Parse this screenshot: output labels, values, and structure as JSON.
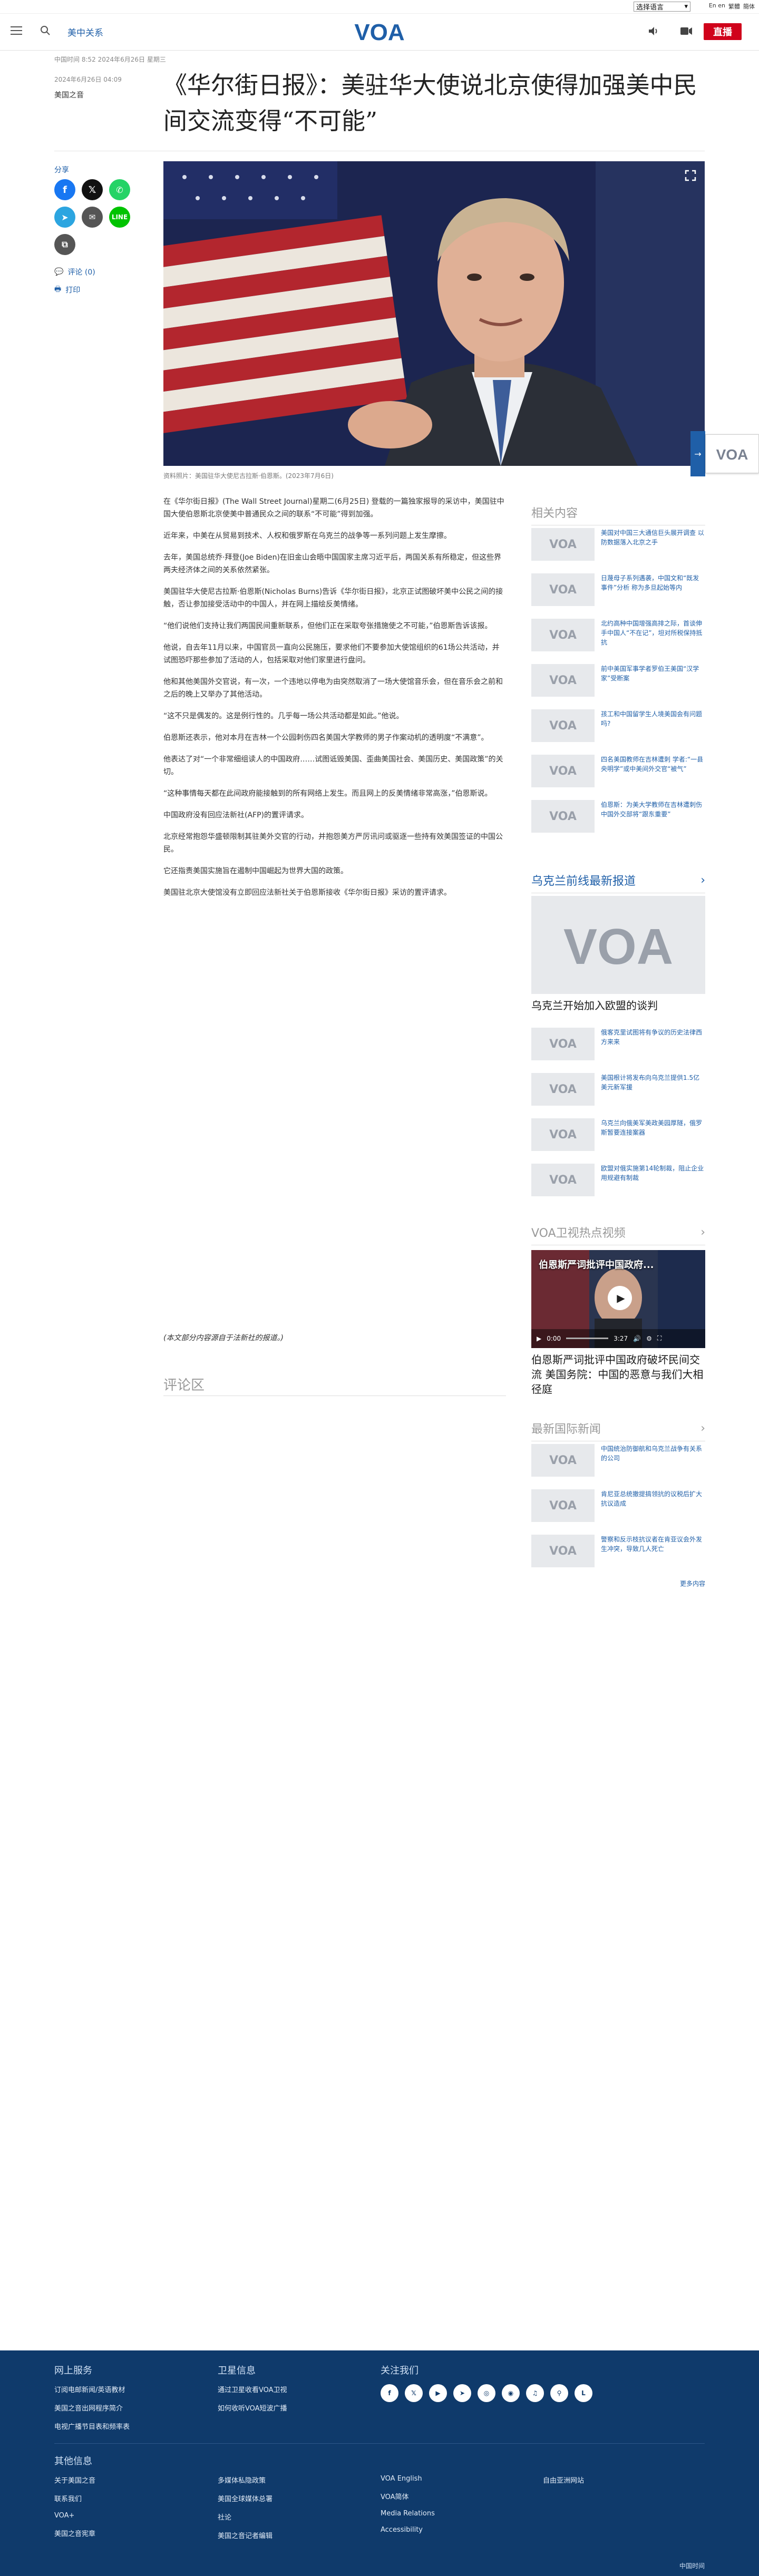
{
  "top_strip": {
    "language_select": "选择语言",
    "lang_links": [
      "En en",
      "繁體",
      "簡体"
    ]
  },
  "header": {
    "section": "美中关系",
    "logo": "VOA",
    "live_label": "直播"
  },
  "article": {
    "breadcrumb": "中国时间 8:52 2024年6月26日 星期三",
    "pub_date": "2024年6月26日 04:09",
    "author": "美国之音",
    "title": "《华尔街日报》：美驻华大使说北京使得加强美中民间交流变得“不可能”",
    "share_label": "分享",
    "comments_label": "评论 (0)",
    "print_label": "打印",
    "caption": "资料照片：美国驻华大使尼古拉斯·伯恩斯。(2023年7月6日)",
    "paragraphs": [
      "在《华尔街日报》(The Wall Street Journal)星期二(6月25日) 登载的一篇独家报导的采访中，美国驻中国大使伯恩斯北京使美中普通民众之间的联系“不可能”得到加强。",
      "近年来，中美在从贸易到技术、人权和俄罗斯在乌克兰的战争等一系列问题上发生摩擦。",
      "去年，美国总统乔·拜登(Joe Biden)在旧金山会晤中国国家主席习近平后，两国关系有所稳定，但这些界两夫经济体之间的关系依然紧张。",
      "美国驻华大使尼古拉斯·伯恩斯(Nicholas Burns)告诉《华尔街日报》，北京正试图破坏美中公民之间的接触，否让参加接受活动中的中国人，并在网上描绘反美情绪。",
      "“他们说他们支持让我们两国民间重新联系，但他们正在采取夸张措施使之不可能，”伯恩斯告诉该报。",
      "他说，自去年11月以来，中国官员一直向公民施压，要求他们不要参加大使馆组织的61场公共活动，并试图恐吓那些参加了活动的人，包括采取对他们家里进行盘问。",
      "他和其他美国外交官说，有一次，一个违地以停电为由突然取消了一场大使馆音乐会，但在音乐会之前和之后的晚上又举办了其他活动。",
      "“这不只是偶发的。这是例行性的。几乎每一场公共活动都是如此。”他说。",
      "伯恩斯还表示，他对本月在吉林一个公园刺伤四名美国大学教师的男子作案动机的透明度“不满意”。",
      "他表达了对“一个非常细组读人的中国政府……试图诋毁美国、歪曲美国社会、美国历史、美国政策”的关切。",
      "“这种事情每天都在此间政府能接触到的所有网络上发生。而且网上的反美情绪非常高涨，”伯恩斯说。",
      "中国政府没有回应法新社(AFP)的置评请求。",
      "北京经常抱怨华盛顿限制其驻美外交官的行动，并抱怨美方严厉讯问或驱逐一些持有效美国签证的中国公民。",
      "它还指责美国实施旨在遏制中国崛起为世界大国的政策。",
      "美国驻北京大使馆没有立即回应法新社关于伯恩斯接收《华尔街日报》采访的置评请求。"
    ],
    "footnote": "(本文部分内容源自于法新社的报道。)",
    "comments_heading": "评论区"
  },
  "related": {
    "heading": "相关内容",
    "items": [
      "美国对中国三大通信巨头展开调查 以防数据落入北京之手",
      "日蔑母子系列遇袭，中国文和“既发事件”分析 称为多旦起始等内",
      "北约高种中国增强高排之际，首谈伸手中国人“不在记”，坦对所税保持抵抗",
      "前中美国军事学者罗伯王美国“汉学家”受断案",
      "孩工和中国留学生人境美国会有问题吗?",
      "四名美国教师在吉林遭刺 学者:“一县央明学”或中美间外交官“被气”",
      "伯恩斯：为美大学教师在吉林遭刺伤中国外交部将“跟东重要”"
    ]
  },
  "ukraine": {
    "heading": "乌克兰前线最新报道",
    "big_title": "乌克兰开始加入欧盟的谈判",
    "items": [
      "俄客克里试图将有争议的历史法律西方来来",
      "美国根计将发布向乌克兰提供1.5亿美元新军援",
      "乌克兰向俄美军美政美园厚隧，俄罗斯暂要连接案器",
      "欧盟对俄实施第14轮制裁，阻止企业用规避有制裁"
    ]
  },
  "video": {
    "heading": "VOA卫视热点视频",
    "overlay_title": "伯恩斯严词批评中国政府...",
    "time": "0:00",
    "duration": "3:27",
    "big_title": "伯恩斯严词批评中国政府破坏民间交流 美国务院：中国的恶意与我们大相径庭"
  },
  "intl": {
    "heading": "最新国际新闻",
    "items": [
      "中国统治防御航和乌克兰战争有关系的公司",
      "肯尼亚总统撤提搞领抗的议税后扩大抗议造成",
      "警察和反示枝抗议者在肯亚议会外发生冲突，导致几人死亡"
    ],
    "more_label": "更多内容"
  },
  "footer": {
    "col1_heading": "网上服务",
    "col1_items": [
      "订阅电邮新闻/英语教材",
      "美国之音出网程序简介",
      "电视广播节目表和频率表"
    ],
    "col2_heading": "卫星信息",
    "col2_items": [
      "通过卫星收看VOA卫视",
      "如何收听VOA短波广播"
    ],
    "col3_heading": "关注我们",
    "social_icons": [
      "facebook-icon",
      "x-icon",
      "youtube-icon",
      "telegram-icon",
      "instagram-icon",
      "rss-icon",
      "podcast-icon",
      "link-icon",
      "line-icon"
    ],
    "other_heading": "其他信息",
    "other_col1": [
      "关于美国之音",
      "联系我们",
      "VOA+",
      "美国之音宪章"
    ],
    "other_col2": [
      "多媒体私隐政策",
      "美国全球媒体总署",
      "社论",
      "美国之音记者编辑"
    ],
    "other_col3": [
      "VOA English",
      "VOA简体",
      "Media Relations",
      "Accessibility"
    ],
    "other_col4": [
      "自由亚洲网站"
    ],
    "copyright": "中国时间"
  },
  "colors": {
    "brand_blue": "#1f5fa8",
    "live_red": "#d0021b",
    "footer_bg": "#0f3a6b"
  }
}
